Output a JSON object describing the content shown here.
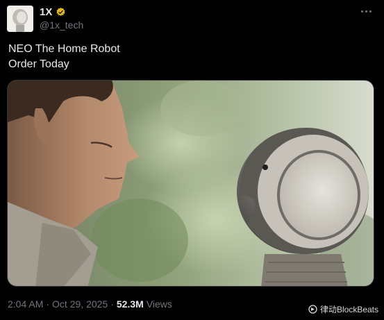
{
  "post": {
    "author": {
      "display_name": "1X",
      "handle": "@1x_tech",
      "verified_badge": "verified-gold-icon",
      "badge_color": "#e2b719"
    },
    "more_menu_icon": "more-horizontal-icon",
    "text_lines": [
      "NEO The Home Robot",
      "Order Today"
    ],
    "media": {
      "type": "image"
    },
    "footer": {
      "time": "2:04 AM",
      "separator": "·",
      "date": "Oct 29, 2025",
      "views_count": "52.3M",
      "views_label": "Views"
    }
  },
  "watermark": {
    "icon": "blockbeats-logo-icon",
    "text": "律动BlockBeats"
  },
  "colors": {
    "background": "#000000",
    "primary_text": "#e7e9ea",
    "secondary_text": "#71767b"
  }
}
